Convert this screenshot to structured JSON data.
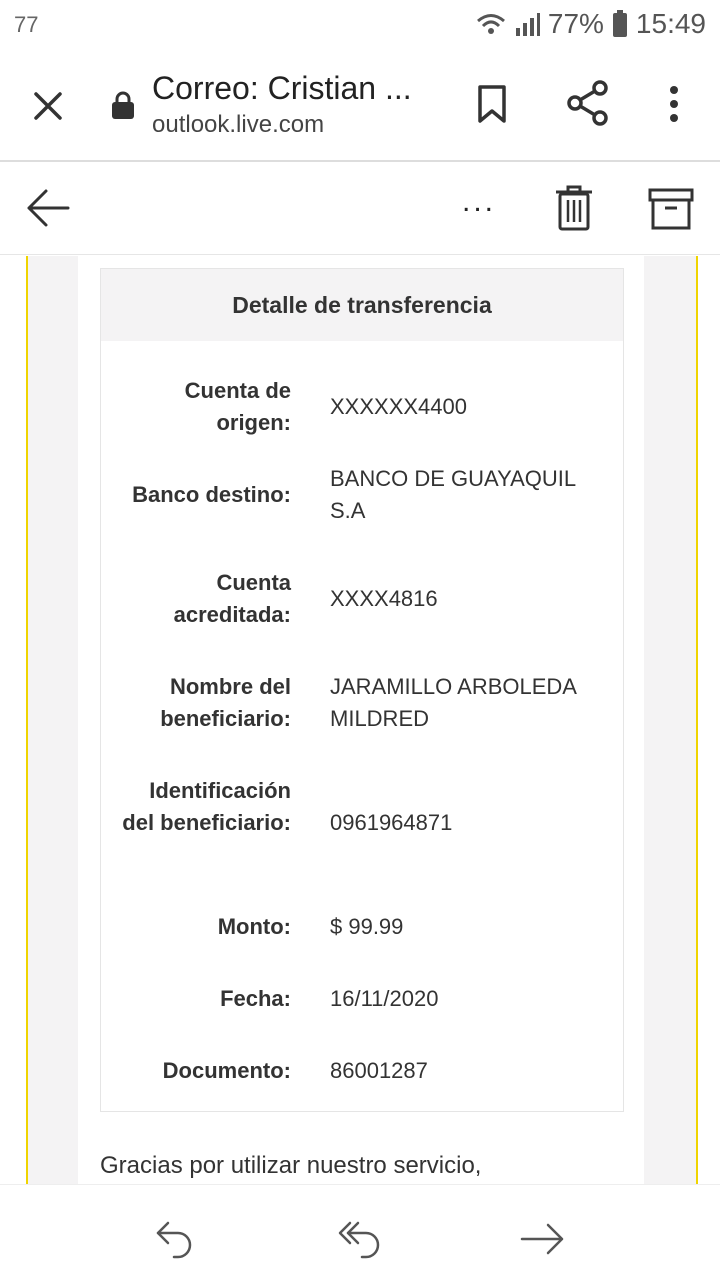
{
  "status_bar": {
    "left_text": "77",
    "battery": "77%",
    "time": "15:49"
  },
  "browser": {
    "title": "Correo: Cristian ...",
    "url": "outlook.live.com",
    "icons": [
      "close-icon",
      "lock-icon",
      "bookmark-icon",
      "share-icon",
      "more-vertical-icon"
    ]
  },
  "mail_toolbar": {
    "more_label": "...",
    "icons": [
      "back-arrow-icon",
      "more-horizontal-icon",
      "trash-icon",
      "archive-icon"
    ]
  },
  "detail": {
    "header": "Detalle de transferencia",
    "rows": [
      {
        "label": "Cuenta de origen:",
        "value": "XXXXXX4400"
      },
      {
        "label": "Banco destino:",
        "value": "BANCO DE GUAYAQUIL S.A"
      },
      {
        "label": "Cuenta acreditada:",
        "value": "XXXX4816"
      },
      {
        "label": "Nombre del beneficiario:",
        "value": "JARAMILLO ARBOLEDA MILDRED"
      },
      {
        "label": "Identificación del beneficiario:",
        "value": "0961964871"
      },
      {
        "label": "Monto:",
        "value": "$ 99.99"
      },
      {
        "label": "Fecha:",
        "value": "16/11/2020"
      },
      {
        "label": "Documento:",
        "value": "86001287"
      }
    ]
  },
  "email_footer": {
    "thanks": "Gracias por utilizar nuestro servicio,"
  },
  "bottom_bar": {
    "icons": [
      "reply-icon",
      "reply-all-icon",
      "forward-icon"
    ]
  },
  "colors": {
    "accent_border": "#f0d400",
    "header_bg": "#f4f3f4"
  }
}
